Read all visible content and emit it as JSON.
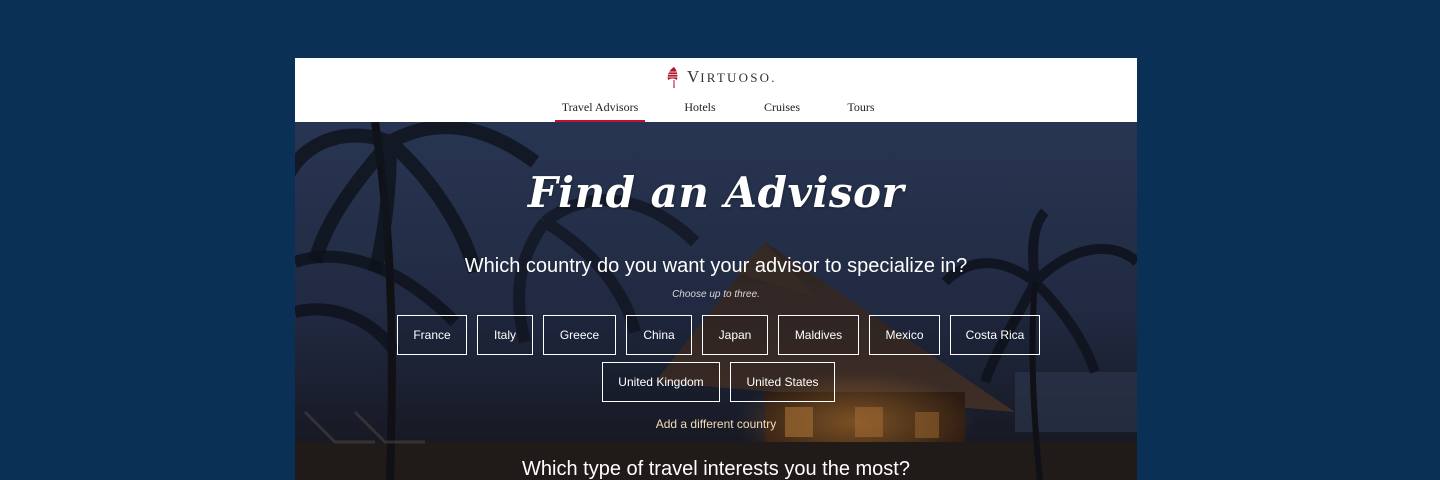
{
  "brand": {
    "logo_initial": "V",
    "logo_rest": "IRTUOSO",
    "logo_trademark": ".",
    "logo_mark": "virtuoso-sail-icon",
    "accent_color": "#c8102e",
    "page_bg_color": "#0a3056"
  },
  "nav": {
    "items": [
      {
        "label": "Travel Advisors",
        "active": true
      },
      {
        "label": "Hotels",
        "active": false
      },
      {
        "label": "Cruises",
        "active": false
      },
      {
        "label": "Tours",
        "active": false
      }
    ]
  },
  "hero": {
    "title": "Find an Advisor",
    "question_country": "Which country do you want your advisor to specialize in?",
    "hint": "Choose up to three.",
    "countries": [
      "France",
      "Italy",
      "Greece",
      "China",
      "Japan",
      "Maldives",
      "Mexico",
      "Costa Rica",
      "United Kingdom",
      "United States"
    ],
    "add_country_link": "Add a different country",
    "question_interest": "Which type of travel interests you the most?"
  }
}
